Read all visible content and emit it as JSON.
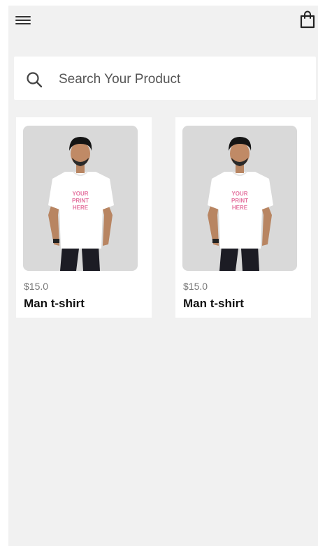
{
  "header": {
    "menu_icon": "hamburger-menu-icon",
    "cart_icon": "shopping-bag-icon"
  },
  "search": {
    "placeholder": "Search Your Product",
    "icon": "search-icon"
  },
  "products": [
    {
      "price": "$15.0",
      "name": "Man t-shirt",
      "shirt_text": "YOUR\nPRINT\nHERE"
    },
    {
      "price": "$15.0",
      "name": "Man t-shirt",
      "shirt_text": "YOUR\nPRINT\nHERE"
    }
  ],
  "colors": {
    "background": "#f1f1f1",
    "card": "#ffffff",
    "image_bg": "#d9d9d9",
    "print_text": "#e4739f"
  }
}
